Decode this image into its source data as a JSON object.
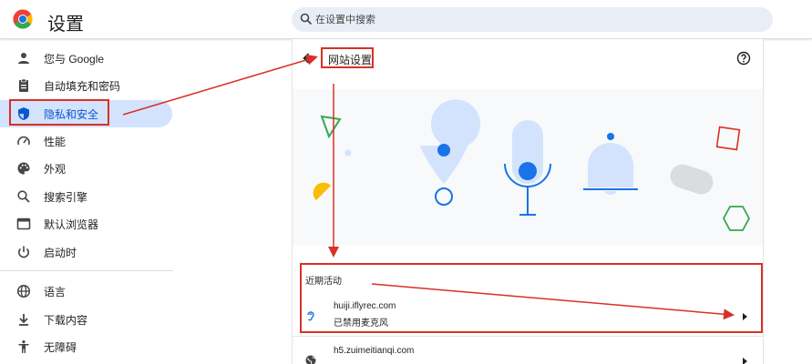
{
  "header": {
    "title": "设置",
    "search_placeholder": "在设置中搜索"
  },
  "sidebar": {
    "items": [
      {
        "label": "您与 Google",
        "icon": "person-icon"
      },
      {
        "label": "自动填充和密码",
        "icon": "clipboard-icon"
      },
      {
        "label": "隐私和安全",
        "icon": "shield-icon",
        "active": true
      },
      {
        "label": "性能",
        "icon": "speedometer-icon"
      },
      {
        "label": "外观",
        "icon": "palette-icon"
      },
      {
        "label": "搜索引擎",
        "icon": "search-icon"
      },
      {
        "label": "默认浏览器",
        "icon": "browser-icon"
      },
      {
        "label": "启动时",
        "icon": "power-icon"
      },
      {
        "label": "语言",
        "icon": "globe-icon"
      },
      {
        "label": "下载内容",
        "icon": "download-icon"
      },
      {
        "label": "无障碍",
        "icon": "accessibility-icon"
      }
    ]
  },
  "main": {
    "page_title": "网站设置",
    "recent_activity_title": "近期活动",
    "recent_sites": [
      {
        "domain": "huiji.iflyrec.com",
        "status": "已禁用麦克风",
        "icon": "ear-icon"
      },
      {
        "domain": "h5.zuimeitianqi.com",
        "status": "",
        "icon": "globe-icon"
      }
    ]
  },
  "colors": {
    "accent": "#0b57d0",
    "active_bg": "#d3e3fd",
    "annotation_red": "#d93025",
    "illustration_blue": "#d3e3fd",
    "illustration_dark_blue": "#1a73e8"
  }
}
